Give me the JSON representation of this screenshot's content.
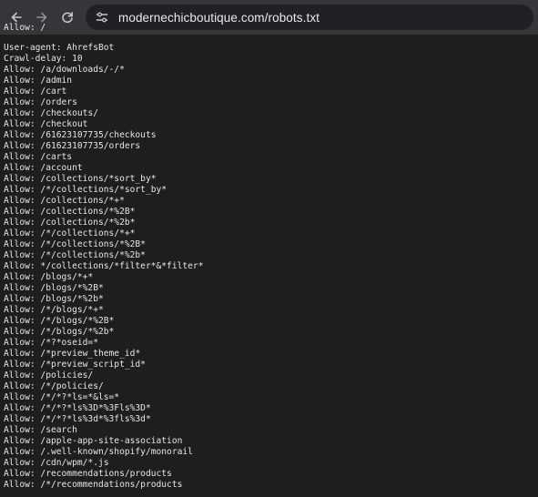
{
  "browser": {
    "url": "modernechicboutique.com/robots.txt"
  },
  "icons": {
    "back": "arrow-left-icon",
    "forward": "arrow-right-icon",
    "reload": "reload-icon",
    "site_info": "tune-icon"
  },
  "colors": {
    "toolbar_bg": "#35363a",
    "omnibox_bg": "#202124",
    "page_bg": "#1e1e1e",
    "text": "#e6e6e6"
  },
  "robots": {
    "partial_top": "Allow: /",
    "lines": [
      "User-agent: AhrefsBot",
      "Crawl-delay: 10",
      "Allow: /a/downloads/-/*",
      "Allow: /admin",
      "Allow: /cart",
      "Allow: /orders",
      "Allow: /checkouts/",
      "Allow: /checkout",
      "Allow: /61623107735/checkouts",
      "Allow: /61623107735/orders",
      "Allow: /carts",
      "Allow: /account",
      "Allow: /collections/*sort_by*",
      "Allow: /*/collections/*sort_by*",
      "Allow: /collections/*+*",
      "Allow: /collections/*%2B*",
      "Allow: /collections/*%2b*",
      "Allow: /*/collections/*+*",
      "Allow: /*/collections/*%2B*",
      "Allow: /*/collections/*%2b*",
      "Allow: */collections/*filter*&*filter*",
      "Allow: /blogs/*+*",
      "Allow: /blogs/*%2B*",
      "Allow: /blogs/*%2b*",
      "Allow: /*/blogs/*+*",
      "Allow: /*/blogs/*%2B*",
      "Allow: /*/blogs/*%2b*",
      "Allow: /*?*oseid=*",
      "Allow: /*preview_theme_id*",
      "Allow: /*preview_script_id*",
      "Allow: /policies/",
      "Allow: /*/policies/",
      "Allow: /*/*?*ls=*&ls=*",
      "Allow: /*/*?*ls%3D*%3Fls%3D*",
      "Allow: /*/*?*ls%3d*%3fls%3d*",
      "Allow: /search",
      "Allow: /apple-app-site-association",
      "Allow: /.well-known/shopify/monorail",
      "Allow: /cdn/wpm/*.js",
      "Allow: /recommendations/products",
      "Allow: /*/recommendations/products"
    ]
  }
}
